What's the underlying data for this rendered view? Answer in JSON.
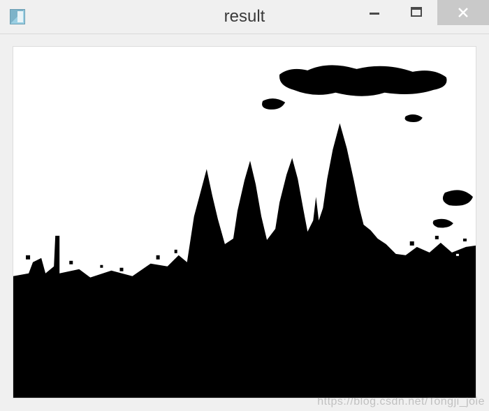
{
  "window": {
    "title": "result",
    "icon": "image-viewer-icon"
  },
  "controls": {
    "minimize": "minimize-icon",
    "maximize": "maximize-icon",
    "close": "close-icon"
  },
  "content": {
    "description": "Binary (black/white) thresholded image showing a dark castle / cathedral silhouette with multiple spires against a white sky, with a dark elongated cloud in the upper right.",
    "foreground_color": "#000000",
    "background_color": "#ffffff"
  },
  "watermark": "https://blog.csdn.net/Tongji_joie"
}
